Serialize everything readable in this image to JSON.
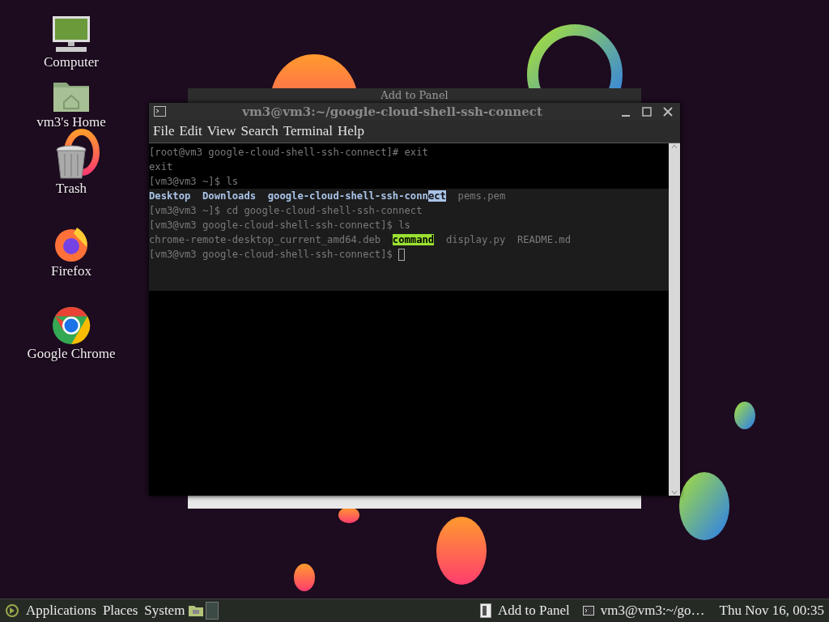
{
  "desktop_icons": [
    {
      "label": "Computer",
      "kind": "computer"
    },
    {
      "label": "vm3's Home",
      "kind": "home"
    },
    {
      "label": "Trash",
      "kind": "trash"
    },
    {
      "label": "Firefox",
      "kind": "firefox"
    },
    {
      "label": "Google Chrome",
      "kind": "chrome"
    }
  ],
  "background_window": {
    "title": "Add to Panel"
  },
  "terminal": {
    "title": "vm3@vm3:~/google-cloud-shell-ssh-connect",
    "menu": [
      "File",
      "Edit",
      "View",
      "Search",
      "Terminal",
      "Help"
    ],
    "lines": [
      {
        "segments": [
          {
            "text": "[root@vm3 google-cloud-shell-ssh-connect]# exit",
            "kind": "dim"
          }
        ]
      },
      {
        "segments": [
          {
            "text": "exit",
            "kind": "dim"
          }
        ]
      },
      {
        "segments": [
          {
            "text": "[vm3@vm3 ~]$ ls",
            "kind": "dim"
          }
        ]
      },
      {
        "segments": [
          {
            "text": "Desktop  Downloads  google-cloud-shell-ssh-conn",
            "kind": "dir"
          },
          {
            "text": "ect",
            "kind": "selected"
          },
          {
            "text": "  pems.pem",
            "kind": "dim"
          }
        ]
      },
      {
        "segments": [
          {
            "text": "[vm3@vm3 ~]$ cd google-cloud-shell-ssh-connect",
            "kind": "dim"
          }
        ]
      },
      {
        "segments": [
          {
            "text": "[vm3@vm3 google-cloud-shell-ssh-connect]$ ls",
            "kind": "dim"
          }
        ]
      },
      {
        "segments": [
          {
            "text": "chrome-remote-desktop_current_amd64.deb  ",
            "kind": "dim"
          },
          {
            "text": "command",
            "kind": "exec"
          },
          {
            "text": "  display.py  README.md",
            "kind": "dim"
          }
        ]
      },
      {
        "segments": [
          {
            "text": "[vm3@vm3 google-cloud-shell-ssh-connect]$ ",
            "kind": "dim"
          }
        ],
        "cursor": true
      }
    ]
  },
  "panel": {
    "menus": [
      "Applications",
      "Places",
      "System"
    ],
    "applets": [
      {
        "label": "Add to Panel",
        "kind": "dialog"
      },
      {
        "label": "vm3@vm3:~/go…",
        "kind": "terminal"
      }
    ],
    "clock": "Thu Nov 16, 00:35"
  }
}
